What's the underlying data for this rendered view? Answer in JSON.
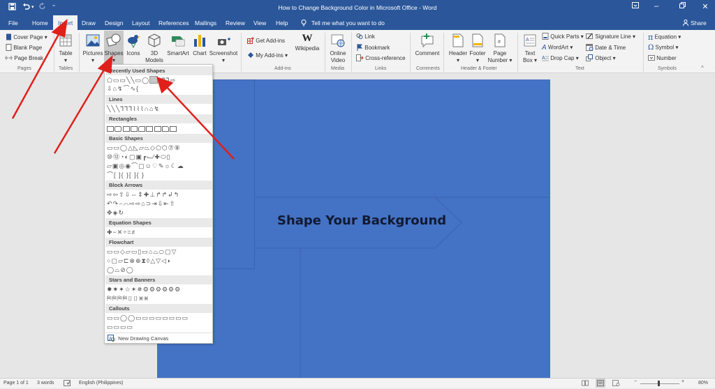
{
  "window": {
    "title": "How to Change Background Color in Microsoft Office  -  Word",
    "controls": [
      "ribbon-display-options",
      "minimize",
      "restore",
      "close"
    ]
  },
  "quick_access": {
    "save": "save-icon",
    "undo": "undo-icon",
    "redo": "redo-icon",
    "customize": "customize-icon"
  },
  "tabs": [
    "File",
    "Home",
    "Insert",
    "Draw",
    "Design",
    "Layout",
    "References",
    "Mailings",
    "Review",
    "View",
    "Help"
  ],
  "active_tab": "Insert",
  "tell_me": "Tell me what you want to do",
  "share": "Share",
  "ribbon": {
    "pages": {
      "label": "Pages",
      "items": [
        "Cover Page",
        "Blank Page",
        "Page Break"
      ]
    },
    "tables": {
      "label": "Tables",
      "items": [
        "Table"
      ]
    },
    "illustrations": {
      "items": [
        "Pictures",
        "Shapes",
        "Icons",
        "3D",
        "Models",
        "SmartArt",
        "Chart",
        "Screenshot"
      ]
    },
    "addins": {
      "label": "Add-ins",
      "items": [
        "Get Add-ins",
        "My Add-ins",
        "Wikipedia"
      ]
    },
    "media": {
      "label": "Media",
      "items": [
        "Online",
        "Video"
      ]
    },
    "links": {
      "label": "Links",
      "items": [
        "Link",
        "Bookmark",
        "Cross-reference"
      ]
    },
    "comments": {
      "label": "Comments",
      "items": [
        "Comment"
      ]
    },
    "header_footer": {
      "label": "Header & Footer",
      "items": [
        "Header",
        "Footer",
        "Page",
        "Number"
      ]
    },
    "text": {
      "label": "Text",
      "items": [
        "Text",
        "Box",
        "Quick Parts",
        "WordArt",
        "Drop Cap",
        "Signature Line",
        "Date & Time",
        "Object"
      ]
    },
    "symbols": {
      "label": "Symbols",
      "items": [
        "Equation",
        "Symbol",
        "Number"
      ]
    }
  },
  "shapes_menu": {
    "categories": [
      "Recently Used Shapes",
      "Lines",
      "Rectangles",
      "Basic Shapes",
      "Block Arrows",
      "Equation Shapes",
      "Flowchart",
      "Stars and Banners",
      "Callouts"
    ],
    "rows": {
      "recent1": "⬠▭▭╲╲▭◯▭△⅂⅂⇨",
      "recent2": "⇩⌂↯⌒∿{",
      "lines": "╲╲╲⅂⅂⅂⌇⌇⌇∩⌂↯",
      "basic1": "▭▭◯△◺▱⏢◇⬠⬡⑦⑧",
      "basic2": "⑩⑫◔◐▢▣┏⌙⁄✚⬭▯",
      "basic3": "▱▣◎◉⌒▢☺♡✎☼☾☁",
      "basic4": "⌒[ ]{ }[ ]{ }",
      "arrows1": "⇨⇦⇧⇩⇔⇕✚⊥↱↱↲↰",
      "arrows2": "↶↷⌣⌒⇨⇨⌂⊃⇥⇩⇤⇧",
      "arrows3": "✥◈↻",
      "equation": "✚−✕÷=≠",
      "flow1": "▭▭◇▱▭▯▭⌂⌓⬭▢▽",
      "flow2": "○▢▱⊏⊗⊕⧗◊△▽◁◗",
      "flow3": "◯⌓⊘◯",
      "stars1": "✹✷✦☆✶✵⚙⚙⚙⚙⚙⚙",
      "stars2": "⛿⛿⛿⛿▯▯⌘⌘",
      "callouts1": "▭▭◯◯▭▭▭▭▭▭▭▭",
      "callouts2": "▭▭▭▭"
    },
    "new_canvas": "New Drawing Canvas"
  },
  "document": {
    "shape_text": "Shape Your Background",
    "background_color": "#4472c4"
  },
  "status": {
    "page": "Page 1 of 1",
    "words": "3 words",
    "language": "English (Philippines)",
    "zoom": "80%"
  },
  "colors": {
    "brand": "#2b579a",
    "annotation_arrow": "#e0201b"
  }
}
